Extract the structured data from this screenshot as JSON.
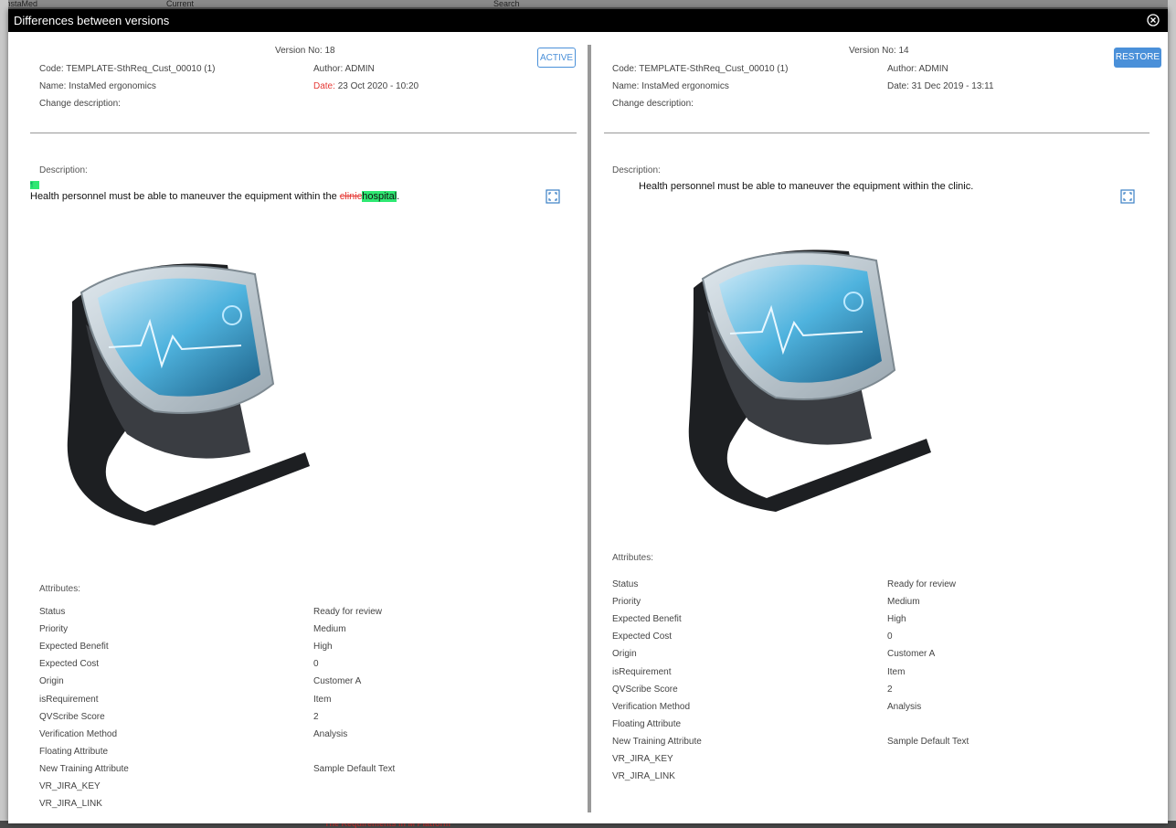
{
  "background": {
    "top_items": [
      "InstaMed",
      "Current",
      "Search"
    ],
    "bottom_text": "The Requirements in M Platform"
  },
  "dialog": {
    "title": "Differences between versions"
  },
  "left": {
    "version": "Version No: 18",
    "code": "Code: TEMPLATE-SthReq_Cust_00010 (1)",
    "name": "Name: InstaMed ergonomics",
    "change": "Change description:",
    "author": "Author: ADMIN",
    "date_label": "Date:",
    "date_value": "23 Oct 2020 - 10:20",
    "button": "ACTIVE",
    "description_label": "Description:",
    "marker": "¶",
    "desc_before": "Health personnel must be able to maneuver the equipment within the ",
    "desc_deleted": "clinic",
    "desc_inserted": "hospital",
    "desc_after": ".",
    "attributes_title": "Attributes:",
    "attributes": [
      {
        "k": "Status",
        "v": "Ready for review"
      },
      {
        "k": "Priority",
        "v": "Medium"
      },
      {
        "k": "Expected Benefit",
        "v": "High"
      },
      {
        "k": "Expected Cost",
        "v": "0"
      },
      {
        "k": "Origin",
        "v": "Customer A"
      },
      {
        "k": "isRequirement",
        "v": "Item"
      },
      {
        "k": "QVScribe Score",
        "v": "2"
      },
      {
        "k": "Verification Method",
        "v": "Analysis"
      },
      {
        "k": "Floating Attribute",
        "v": ""
      },
      {
        "k": "New Training Attribute",
        "v": "Sample Default Text"
      },
      {
        "k": "VR_JIRA_KEY",
        "v": ""
      },
      {
        "k": "VR_JIRA_LINK",
        "v": ""
      }
    ]
  },
  "right": {
    "version": "Version No: 14",
    "code": "Code: TEMPLATE-SthReq_Cust_00010 (1)",
    "name": "Name: InstaMed ergonomics",
    "change": "Change description:",
    "author": "Author: ADMIN",
    "date": "Date: 31 Dec 2019 - 13:11",
    "button": "RESTORE",
    "description_label": "Description:",
    "desc_text": "Health personnel must be able to maneuver the equipment within the clinic.",
    "attributes_title": "Attributes:",
    "attributes": [
      {
        "k": "Status",
        "v": "Ready for review"
      },
      {
        "k": "Priority",
        "v": "Medium"
      },
      {
        "k": "Expected Benefit",
        "v": "High"
      },
      {
        "k": "Expected Cost",
        "v": "0"
      },
      {
        "k": "Origin",
        "v": "Customer A"
      },
      {
        "k": "isRequirement",
        "v": "Item"
      },
      {
        "k": "QVScribe Score",
        "v": "2"
      },
      {
        "k": "Verification Method",
        "v": "Analysis"
      },
      {
        "k": "Floating Attribute",
        "v": ""
      },
      {
        "k": "New Training Attribute",
        "v": "Sample Default Text"
      },
      {
        "k": "VR_JIRA_KEY",
        "v": ""
      },
      {
        "k": "VR_JIRA_LINK",
        "v": ""
      }
    ]
  }
}
